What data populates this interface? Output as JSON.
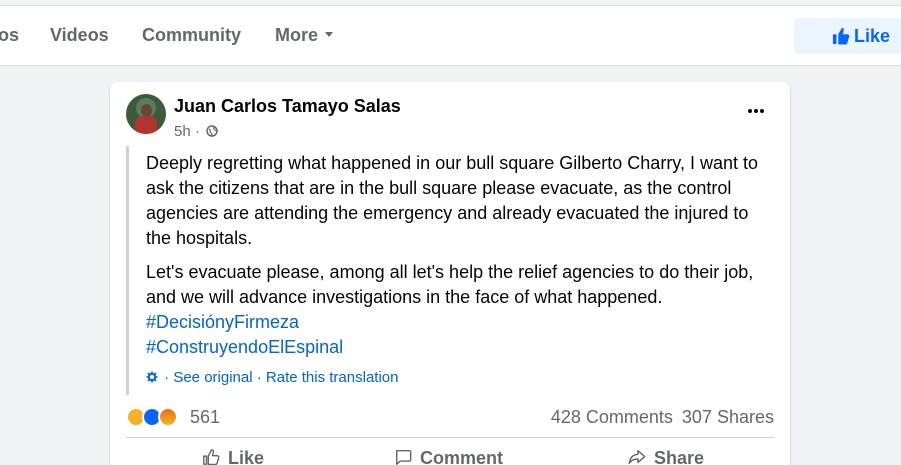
{
  "nav": {
    "items": [
      {
        "label": "os"
      },
      {
        "label": "Videos"
      },
      {
        "label": "Community"
      },
      {
        "label": "More"
      }
    ],
    "like_label": "Like"
  },
  "post": {
    "author": "Juan Carlos Tamayo Salas",
    "time": "5h ·",
    "paragraphs": [
      "Deeply regretting what happened in our bull square Gilberto Charry, I want to ask the citizens that are in the bull square please evacuate, as the control agencies are attending the emergency and already evacuated the injured to the hospitals.",
      "Let's evacuate please, among all let's help the relief agencies to do their job, and we will advance investigations in the face of what happened."
    ],
    "hashtags": [
      "#DecisiónyFirmeza",
      "#ConstruyendoElEspinal"
    ],
    "translation": {
      "see_original": "· See original",
      "separator": " · ",
      "rate": "Rate this translation"
    },
    "reaction_count": "561",
    "comments": "428 Comments",
    "shares": "307 Shares",
    "actions": {
      "like": "Like",
      "comment": "Comment",
      "share": "Share"
    }
  },
  "colors": {
    "accent": "#0866ff",
    "link": "#0064d1",
    "muted": "#65676b",
    "background": "#f0f2f5"
  },
  "icons": [
    "thumbs-up-icon",
    "globe-icon",
    "gear-icon",
    "more-dots-icon",
    "comment-icon",
    "share-icon",
    "sad-reaction-icon",
    "like-reaction-icon",
    "angry-reaction-icon"
  ]
}
